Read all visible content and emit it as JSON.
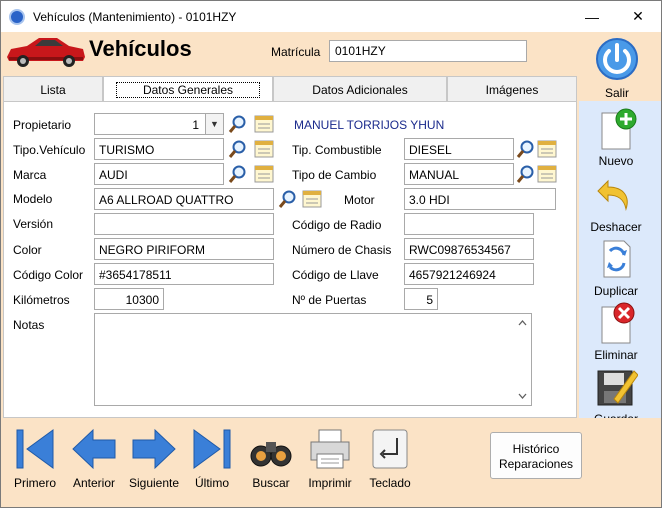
{
  "window": {
    "title": "Vehículos (Mantenimiento) - 0101HZY"
  },
  "header": {
    "title": "Vehículos",
    "matricula_label": "Matrícula",
    "matricula_value": "0101HZY",
    "exit_label": "Salir"
  },
  "tabs": [
    {
      "label": "Lista",
      "active": false
    },
    {
      "label": "Datos Generales",
      "active": true
    },
    {
      "label": "Datos Adicionales",
      "active": false
    },
    {
      "label": "Imágenes",
      "active": false
    }
  ],
  "form": {
    "propietario": {
      "label": "Propietario",
      "value": "1",
      "name": "MANUEL TORRIJOS YHUN"
    },
    "tipo_vehiculo": {
      "label": "Tipo.Vehículo",
      "value": "TURISMO"
    },
    "marca": {
      "label": "Marca",
      "value": "AUDI"
    },
    "modelo": {
      "label": "Modelo",
      "value": "A6 ALLROAD QUATTRO"
    },
    "version": {
      "label": "Versión",
      "value": ""
    },
    "color": {
      "label": "Color",
      "value": "NEGRO PIRIFORM"
    },
    "codigo_color": {
      "label": "Código Color",
      "value": "#3654178511"
    },
    "kilometros": {
      "label": "Kilómetros",
      "value": "10300"
    },
    "notas": {
      "label": "Notas",
      "value": ""
    },
    "tipo_combustible": {
      "label": "Tip. Combustible",
      "value": "DIESEL"
    },
    "tipo_cambio": {
      "label": "Tipo de Cambio",
      "value": "MANUAL"
    },
    "motor": {
      "label": "Motor",
      "value": "3.0 HDI"
    },
    "codigo_radio": {
      "label": "Código de Radio",
      "value": ""
    },
    "numero_chasis": {
      "label": "Número de Chasis",
      "value": "RWC09876534567"
    },
    "codigo_llave": {
      "label": "Código de Llave",
      "value": "4657921246924"
    },
    "num_puertas": {
      "label": "Nº de Puertas",
      "value": "5"
    }
  },
  "side_actions": {
    "nuevo": "Nuevo",
    "deshacer": "Deshacer",
    "duplicar": "Duplicar",
    "eliminar": "Eliminar",
    "guardar": "Guardar"
  },
  "bottom_nav": {
    "primero": "Primero",
    "anterior": "Anterior",
    "siguiente": "Siguiente",
    "ultimo": "Último",
    "buscar": "Buscar",
    "imprimir": "Imprimir",
    "teclado": "Teclado",
    "historico_line1": "Histórico",
    "historico_line2": "Reparaciones"
  },
  "colors": {
    "background": "#fbe3c6",
    "side_panel": "#dce9fb",
    "accent_blue": "#3a7fd8",
    "owner_text": "#1a2a8c"
  }
}
